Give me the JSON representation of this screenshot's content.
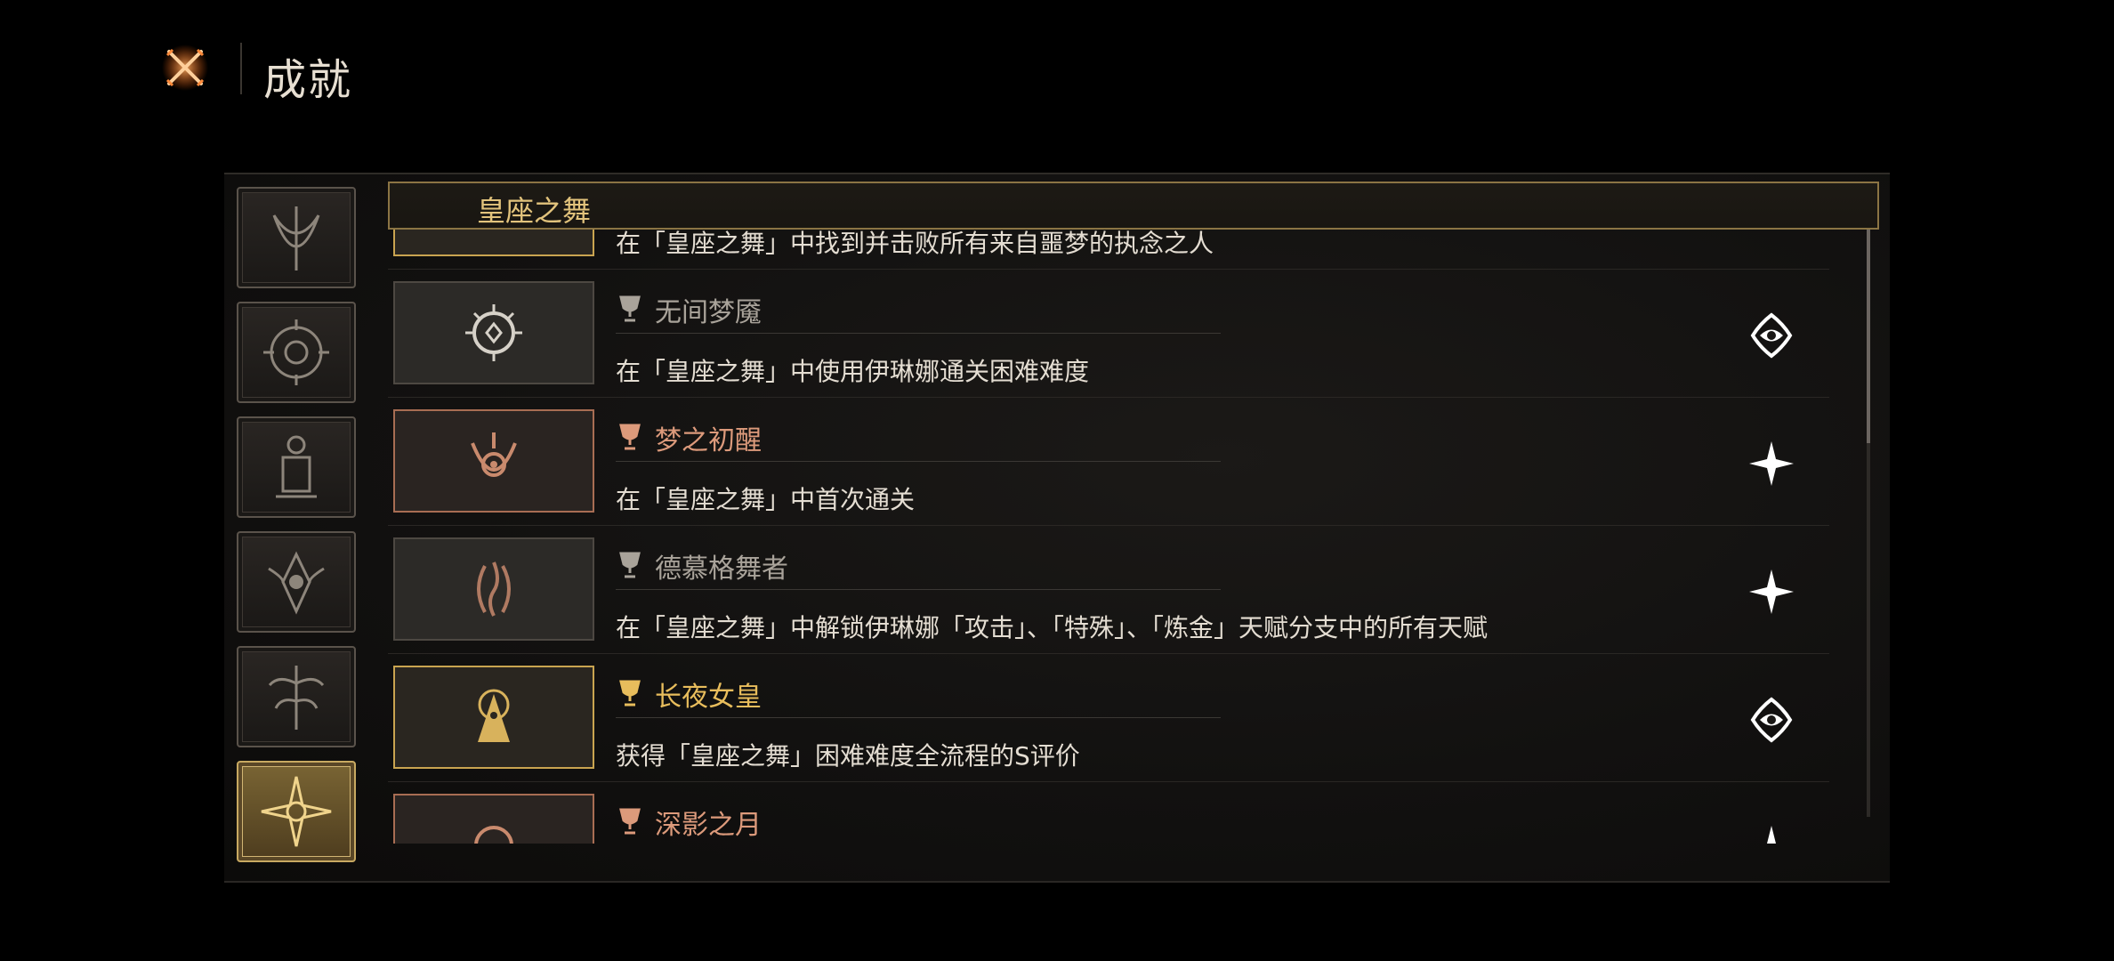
{
  "header": {
    "title": "成就",
    "close_icon": "crossed-swords-close-icon"
  },
  "sidebar": {
    "tabs": [
      {
        "icon": "crescent-blade-emblem-icon",
        "active": false
      },
      {
        "icon": "spiral-sun-emblem-icon",
        "active": false
      },
      {
        "icon": "lantern-emblem-icon",
        "active": false
      },
      {
        "icon": "eye-thorn-emblem-icon",
        "active": false
      },
      {
        "icon": "tree-crest-emblem-icon",
        "active": false
      },
      {
        "icon": "radiant-star-emblem-icon",
        "active": true
      }
    ]
  },
  "section": {
    "title": "皇座之舞"
  },
  "achievements": [
    {
      "name": "",
      "desc": "在「皇座之舞」中找到并击败所有来自噩梦的执念之人",
      "tier": "gold",
      "icon": "crown-emblem-icon",
      "badge": "star-badge-icon"
    },
    {
      "name": "无间梦魇",
      "desc": "在「皇座之舞」中使用伊琳娜通关困难难度",
      "tier": "silver",
      "icon": "thorn-eye-emblem-icon",
      "badge": "eye-badge-icon"
    },
    {
      "name": "梦之初醒",
      "desc": "在「皇座之舞」中首次通关",
      "tier": "bronze",
      "icon": "eye-horns-emblem-icon",
      "badge": "star-badge-icon"
    },
    {
      "name": "德慕格舞者",
      "desc": "在「皇座之舞」中解锁伊琳娜「攻击」、「特殊」、「炼金」天赋分支中的所有天赋",
      "tier": "silver",
      "icon": "dancer-emblem-icon",
      "badge": "star-badge-icon"
    },
    {
      "name": "长夜女皇",
      "desc": "获得「皇座之舞」困难难度全流程的S评价",
      "tier": "gold",
      "icon": "veiled-queen-emblem-icon",
      "badge": "eye-badge-icon"
    },
    {
      "name": "深影之月",
      "desc": "",
      "tier": "bronze",
      "icon": "moon-emblem-icon",
      "badge": "star-badge-icon"
    }
  ],
  "colors": {
    "gold": "#e8bd5c",
    "bronze": "#dc9a7b",
    "silver": "#a9a39a",
    "accent_border": "#8b7444"
  }
}
